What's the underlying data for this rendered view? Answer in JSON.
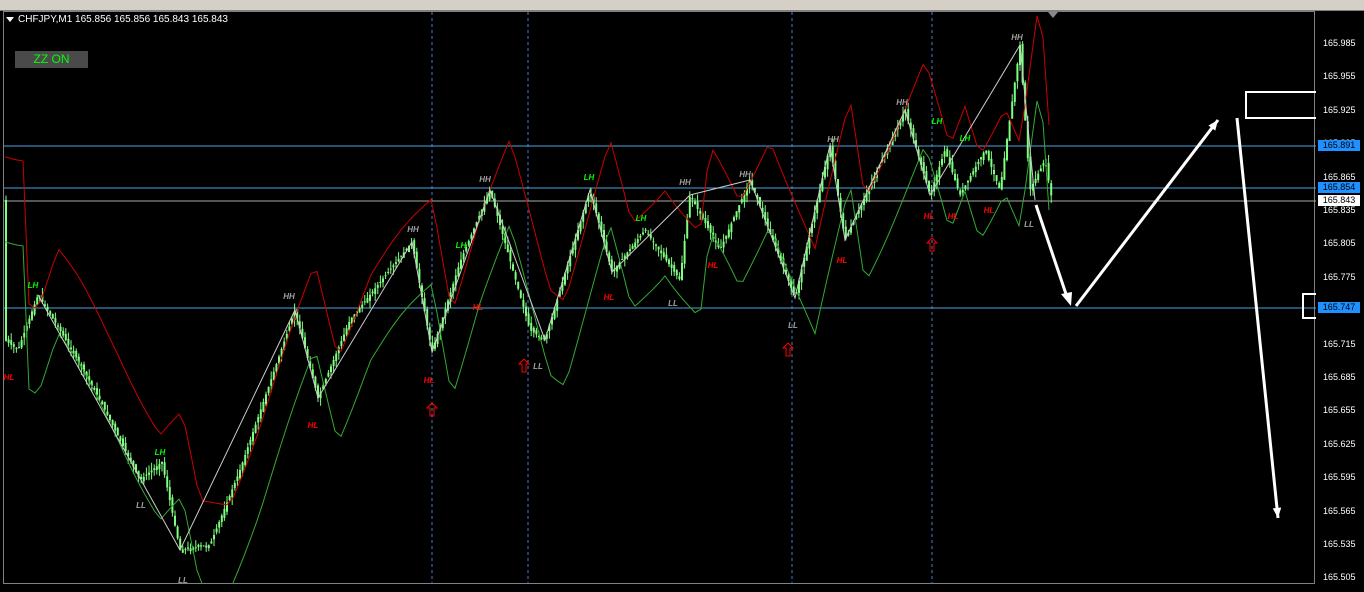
{
  "chart": {
    "symbol_label": "CHFJPY,M1  165.856 165.856 165.843 165.843",
    "zz_button": "ZZ ON"
  },
  "price_axis": {
    "ticks": [
      "165.985",
      "165.955",
      "165.925",
      "165.895",
      "165.865",
      "165.835",
      "165.805",
      "165.775",
      "165.745",
      "165.715",
      "165.685",
      "165.655",
      "165.625",
      "165.595",
      "165.565",
      "165.535",
      "165.505"
    ],
    "tags": [
      {
        "label": "165.891",
        "style": "blue"
      },
      {
        "label": "165.854",
        "style": "blue"
      },
      {
        "label": "165.843",
        "style": "white"
      },
      {
        "label": "165.747",
        "style": "blue"
      }
    ]
  },
  "zigzag_labels": [
    {
      "text": "LH",
      "color": "#00ff00"
    },
    {
      "text": "HL",
      "color": "#ff0000"
    },
    {
      "text": "LH",
      "color": "#00ff00"
    },
    {
      "text": "LL",
      "color": "#a0a0a0"
    },
    {
      "text": "LL",
      "color": "#a0a0a0"
    },
    {
      "text": "HH",
      "color": "#a0a0a0"
    },
    {
      "text": "HL",
      "color": "#ff0000"
    },
    {
      "text": "HH",
      "color": "#a0a0a0"
    },
    {
      "text": "HL",
      "color": "#ff0000"
    },
    {
      "text": "LH",
      "color": "#00ff00"
    },
    {
      "text": "HH",
      "color": "#a0a0a0"
    },
    {
      "text": "HL",
      "color": "#ff0000"
    },
    {
      "text": "LL",
      "color": "#a0a0a0"
    },
    {
      "text": "LH",
      "color": "#00ff00"
    },
    {
      "text": "HL",
      "color": "#ff0000"
    },
    {
      "text": "LH",
      "color": "#00ff00"
    },
    {
      "text": "LL",
      "color": "#a0a0a0"
    },
    {
      "text": "HH",
      "color": "#a0a0a0"
    },
    {
      "text": "HL",
      "color": "#ff0000"
    },
    {
      "text": "HH",
      "color": "#a0a0a0"
    },
    {
      "text": "LL",
      "color": "#a0a0a0"
    },
    {
      "text": "HL",
      "color": "#ff0000"
    },
    {
      "text": "HH",
      "color": "#a0a0a0"
    },
    {
      "text": "HH",
      "color": "#a0a0a0"
    },
    {
      "text": "LH",
      "color": "#00ff00"
    },
    {
      "text": "HL",
      "color": "#ff0000"
    },
    {
      "text": "HL",
      "color": "#ff0000"
    },
    {
      "text": "LH",
      "color": "#00ff00"
    },
    {
      "text": "HL",
      "color": "#ff0000"
    },
    {
      "text": "HH",
      "color": "#a0a0a0"
    },
    {
      "text": "LL",
      "color": "#a0a0a0"
    }
  ],
  "colors": {
    "candle": "#7fff7f",
    "upper_band": "#cc0000",
    "lower_band": "#33aa33",
    "hline": "#4aa3df",
    "vline": "#4a7bd1",
    "arrow": "#ffffff",
    "signal": "#ff0000"
  }
}
